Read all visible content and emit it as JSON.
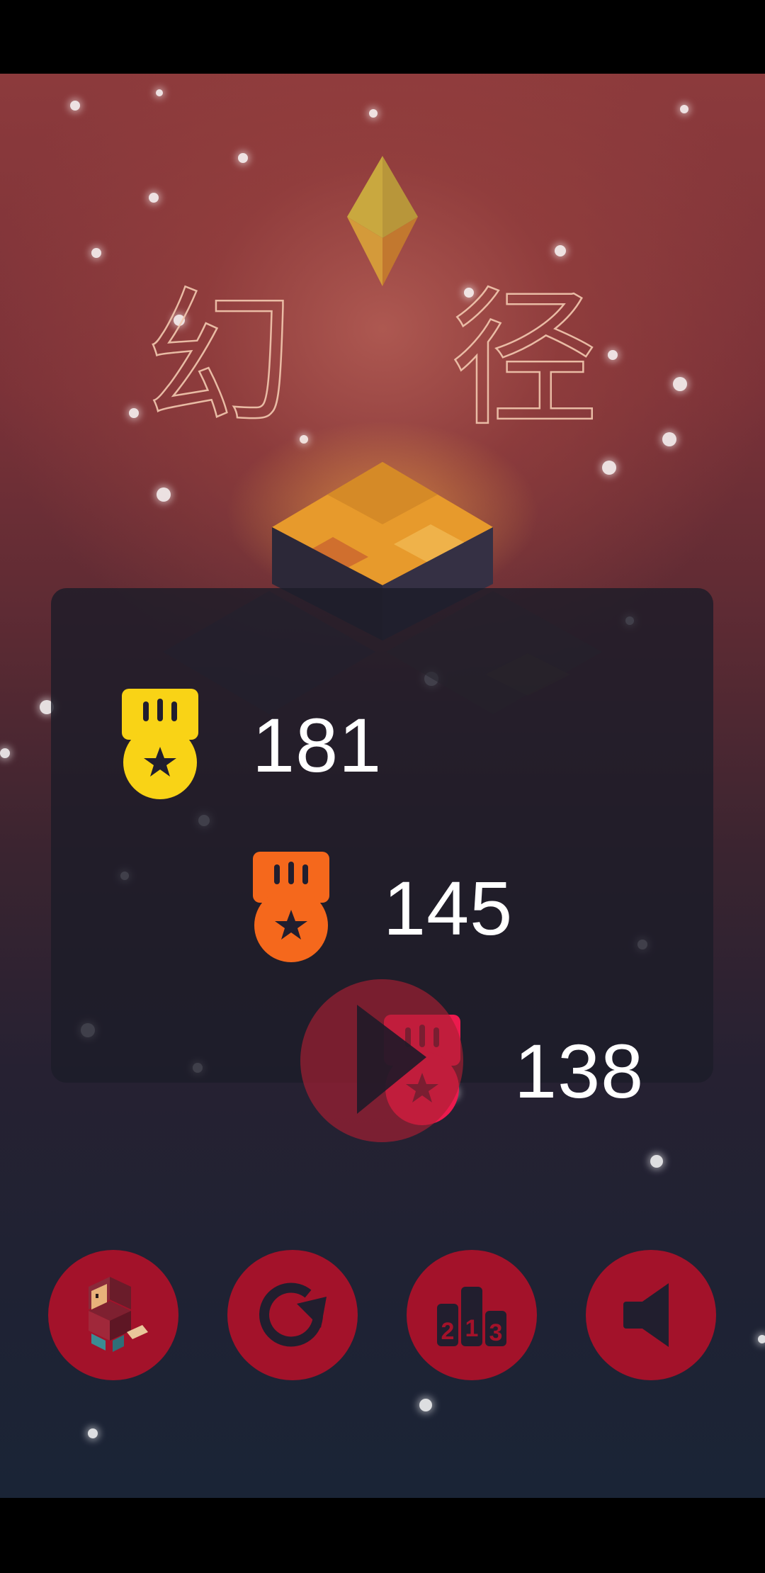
{
  "game": {
    "title_char_1": "幻",
    "title_char_2": "径"
  },
  "scores": [
    {
      "medal": "gold-medal-icon",
      "color": "#f9d316",
      "value": "181"
    },
    {
      "medal": "silver-medal-icon",
      "color": "#f5681c",
      "value": "145"
    },
    {
      "medal": "bronze-medal-icon",
      "color": "#ec1a4e",
      "value": "138"
    }
  ],
  "controls": {
    "play": "play-icon",
    "character": "character-icon",
    "restart": "restart-icon",
    "leaderboard": "leaderboard-icon",
    "leaderboard_digits": [
      "2",
      "1",
      "3"
    ],
    "sound": "speaker-icon"
  },
  "colors": {
    "button": "#a3122a",
    "gem": "#d9a93a"
  }
}
